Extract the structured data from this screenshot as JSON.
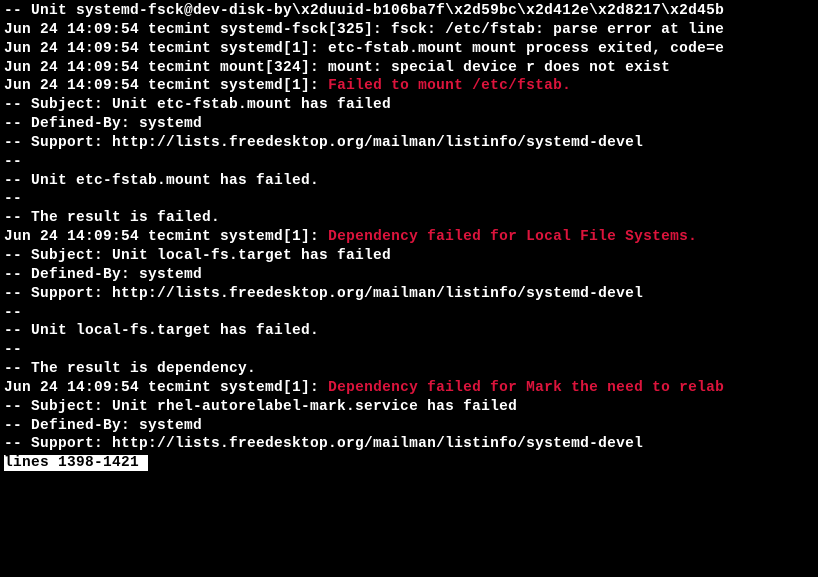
{
  "lines": [
    {
      "segments": [
        {
          "text": "-- Unit systemd-fsck@dev-disk-by\\x2duuid-b106ba7f\\x2d59bc\\x2d412e\\x2d8217\\x2d45b",
          "class": ""
        }
      ]
    },
    {
      "segments": [
        {
          "text": "Jun 24 14:09:54 tecmint systemd-fsck[325]: fsck: /etc/fstab: parse error at line",
          "class": ""
        }
      ]
    },
    {
      "segments": [
        {
          "text": "Jun 24 14:09:54 tecmint systemd[1]: etc-fstab.mount mount process exited, code=e",
          "class": ""
        }
      ]
    },
    {
      "segments": [
        {
          "text": "Jun 24 14:09:54 tecmint mount[324]: mount: special device r does not exist",
          "class": ""
        }
      ]
    },
    {
      "segments": [
        {
          "text": "Jun 24 14:09:54 tecmint systemd[1]: ",
          "class": ""
        },
        {
          "text": "Failed to mount /etc/fstab.",
          "class": "red"
        }
      ]
    },
    {
      "segments": [
        {
          "text": "-- Subject: Unit etc-fstab.mount has failed",
          "class": ""
        }
      ]
    },
    {
      "segments": [
        {
          "text": "-- Defined-By: systemd",
          "class": ""
        }
      ]
    },
    {
      "segments": [
        {
          "text": "-- Support: http://lists.freedesktop.org/mailman/listinfo/systemd-devel",
          "class": ""
        }
      ]
    },
    {
      "segments": [
        {
          "text": "--",
          "class": ""
        }
      ]
    },
    {
      "segments": [
        {
          "text": "-- Unit etc-fstab.mount has failed.",
          "class": ""
        }
      ]
    },
    {
      "segments": [
        {
          "text": "--",
          "class": ""
        }
      ]
    },
    {
      "segments": [
        {
          "text": "-- The result is failed.",
          "class": ""
        }
      ]
    },
    {
      "segments": [
        {
          "text": "Jun 24 14:09:54 tecmint systemd[1]: ",
          "class": ""
        },
        {
          "text": "Dependency failed for Local File Systems.",
          "class": "red"
        }
      ]
    },
    {
      "segments": [
        {
          "text": "-- Subject: Unit local-fs.target has failed",
          "class": ""
        }
      ]
    },
    {
      "segments": [
        {
          "text": "-- Defined-By: systemd",
          "class": ""
        }
      ]
    },
    {
      "segments": [
        {
          "text": "-- Support: http://lists.freedesktop.org/mailman/listinfo/systemd-devel",
          "class": ""
        }
      ]
    },
    {
      "segments": [
        {
          "text": "--",
          "class": ""
        }
      ]
    },
    {
      "segments": [
        {
          "text": "-- Unit local-fs.target has failed.",
          "class": ""
        }
      ]
    },
    {
      "segments": [
        {
          "text": "--",
          "class": ""
        }
      ]
    },
    {
      "segments": [
        {
          "text": "-- The result is dependency.",
          "class": ""
        }
      ]
    },
    {
      "segments": [
        {
          "text": "Jun 24 14:09:54 tecmint systemd[1]: ",
          "class": ""
        },
        {
          "text": "Dependency failed for Mark the need to relab",
          "class": "red"
        }
      ]
    },
    {
      "segments": [
        {
          "text": "-- Subject: Unit rhel-autorelabel-mark.service has failed",
          "class": ""
        }
      ]
    },
    {
      "segments": [
        {
          "text": "-- Defined-By: systemd",
          "class": ""
        }
      ]
    },
    {
      "segments": [
        {
          "text": "-- Support: http://lists.freedesktop.org/mailman/listinfo/systemd-devel",
          "class": ""
        }
      ]
    }
  ],
  "status": "lines 1398-1421"
}
